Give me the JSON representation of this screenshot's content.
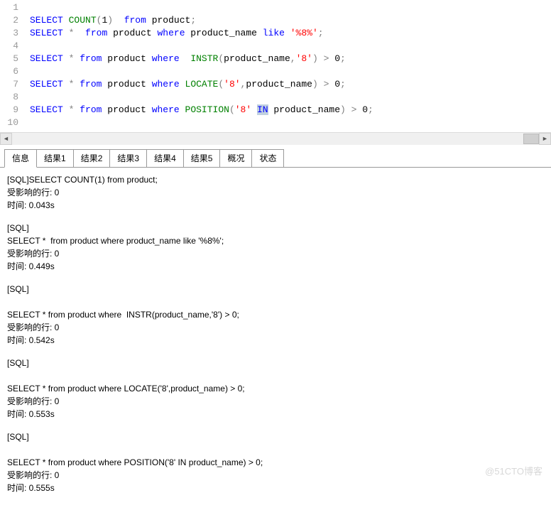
{
  "editor": {
    "lines": [
      {
        "no": "1",
        "tokens": []
      },
      {
        "no": "2",
        "tokens": [
          {
            "c": "kw-blue",
            "t": "SELECT"
          },
          {
            "c": "kw-black",
            "t": " "
          },
          {
            "c": "kw-green",
            "t": "COUNT"
          },
          {
            "c": "kw-gray",
            "t": "("
          },
          {
            "c": "kw-black",
            "t": "1"
          },
          {
            "c": "kw-gray",
            "t": ")"
          },
          {
            "c": "kw-black",
            "t": "  "
          },
          {
            "c": "kw-blue",
            "t": "from"
          },
          {
            "c": "kw-black",
            "t": " product"
          },
          {
            "c": "kw-gray",
            "t": ";"
          }
        ]
      },
      {
        "no": "3",
        "tokens": [
          {
            "c": "kw-blue",
            "t": "SELECT"
          },
          {
            "c": "kw-black",
            "t": " "
          },
          {
            "c": "kw-gray",
            "t": "*"
          },
          {
            "c": "kw-black",
            "t": "  "
          },
          {
            "c": "kw-blue",
            "t": "from"
          },
          {
            "c": "kw-black",
            "t": " product "
          },
          {
            "c": "kw-blue",
            "t": "where"
          },
          {
            "c": "kw-black",
            "t": " product_name "
          },
          {
            "c": "kw-blue",
            "t": "like"
          },
          {
            "c": "kw-black",
            "t": " "
          },
          {
            "c": "kw-red",
            "t": "'%8%'"
          },
          {
            "c": "kw-gray",
            "t": ";"
          }
        ]
      },
      {
        "no": "4",
        "tokens": []
      },
      {
        "no": "5",
        "tokens": [
          {
            "c": "kw-blue",
            "t": "SELECT"
          },
          {
            "c": "kw-black",
            "t": " "
          },
          {
            "c": "kw-gray",
            "t": "*"
          },
          {
            "c": "kw-black",
            "t": " "
          },
          {
            "c": "kw-blue",
            "t": "from"
          },
          {
            "c": "kw-black",
            "t": " product "
          },
          {
            "c": "kw-blue",
            "t": "where"
          },
          {
            "c": "kw-black",
            "t": "  "
          },
          {
            "c": "kw-green",
            "t": "INSTR"
          },
          {
            "c": "kw-gray",
            "t": "("
          },
          {
            "c": "kw-black",
            "t": "product_name"
          },
          {
            "c": "kw-gray",
            "t": ","
          },
          {
            "c": "kw-red",
            "t": "'8'"
          },
          {
            "c": "kw-gray",
            "t": ")"
          },
          {
            "c": "kw-black",
            "t": " "
          },
          {
            "c": "kw-gray",
            "t": ">"
          },
          {
            "c": "kw-black",
            "t": " 0"
          },
          {
            "c": "kw-gray",
            "t": ";"
          }
        ]
      },
      {
        "no": "6",
        "tokens": []
      },
      {
        "no": "7",
        "tokens": [
          {
            "c": "kw-blue",
            "t": "SELECT"
          },
          {
            "c": "kw-black",
            "t": " "
          },
          {
            "c": "kw-gray",
            "t": "*"
          },
          {
            "c": "kw-black",
            "t": " "
          },
          {
            "c": "kw-blue",
            "t": "from"
          },
          {
            "c": "kw-black",
            "t": " product "
          },
          {
            "c": "kw-blue",
            "t": "where"
          },
          {
            "c": "kw-black",
            "t": " "
          },
          {
            "c": "kw-green",
            "t": "LOCATE"
          },
          {
            "c": "kw-gray",
            "t": "("
          },
          {
            "c": "kw-red",
            "t": "'8'"
          },
          {
            "c": "kw-gray",
            "t": ","
          },
          {
            "c": "kw-black",
            "t": "product_name"
          },
          {
            "c": "kw-gray",
            "t": ")"
          },
          {
            "c": "kw-black",
            "t": " "
          },
          {
            "c": "kw-gray",
            "t": ">"
          },
          {
            "c": "kw-black",
            "t": " 0"
          },
          {
            "c": "kw-gray",
            "t": ";"
          }
        ]
      },
      {
        "no": "8",
        "tokens": []
      },
      {
        "no": "9",
        "tokens": [
          {
            "c": "kw-blue",
            "t": "SELECT"
          },
          {
            "c": "kw-black",
            "t": " "
          },
          {
            "c": "kw-gray",
            "t": "*"
          },
          {
            "c": "kw-black",
            "t": " "
          },
          {
            "c": "kw-blue",
            "t": "from"
          },
          {
            "c": "kw-black",
            "t": " product "
          },
          {
            "c": "kw-blue",
            "t": "where"
          },
          {
            "c": "kw-black",
            "t": " "
          },
          {
            "c": "kw-green",
            "t": "POSITION"
          },
          {
            "c": "kw-gray",
            "t": "("
          },
          {
            "c": "kw-red",
            "t": "'8'"
          },
          {
            "c": "kw-black",
            "t": " "
          },
          {
            "c": "kw-blue hl",
            "t": "IN"
          },
          {
            "c": "kw-black",
            "t": " product_name"
          },
          {
            "c": "kw-gray",
            "t": ")"
          },
          {
            "c": "kw-black",
            "t": " "
          },
          {
            "c": "kw-gray",
            "t": ">"
          },
          {
            "c": "kw-black",
            "t": " 0"
          },
          {
            "c": "kw-gray",
            "t": ";"
          }
        ]
      },
      {
        "no": "10",
        "tokens": []
      }
    ]
  },
  "tabs": [
    {
      "label": "信息",
      "active": true
    },
    {
      "label": "结果1",
      "active": false
    },
    {
      "label": "结果2",
      "active": false
    },
    {
      "label": "结果3",
      "active": false
    },
    {
      "label": "结果4",
      "active": false
    },
    {
      "label": "结果5",
      "active": false
    },
    {
      "label": "概况",
      "active": false
    },
    {
      "label": "状态",
      "active": false
    }
  ],
  "output": {
    "blocks": [
      {
        "lines": [
          "[SQL]SELECT COUNT(1) from product;",
          "受影响的行: 0",
          "时间: 0.043s"
        ]
      },
      {
        "lines": [
          "[SQL]",
          "SELECT *  from product where product_name like '%8%';",
          "受影响的行: 0",
          "时间: 0.449s"
        ]
      },
      {
        "lines": [
          "[SQL]",
          "",
          "SELECT * from product where  INSTR(product_name,'8') > 0;",
          "受影响的行: 0",
          "时间: 0.542s"
        ]
      },
      {
        "lines": [
          "[SQL]",
          "",
          "SELECT * from product where LOCATE('8',product_name) > 0;",
          "受影响的行: 0",
          "时间: 0.553s"
        ]
      },
      {
        "lines": [
          "[SQL]",
          "",
          "SELECT * from product where POSITION('8' IN product_name) > 0;",
          "受影响的行: 0",
          "时间: 0.555s"
        ]
      }
    ]
  },
  "watermark": "@51CTO博客",
  "scroll": {
    "left_arrow": "◄",
    "right_arrow": "►"
  }
}
